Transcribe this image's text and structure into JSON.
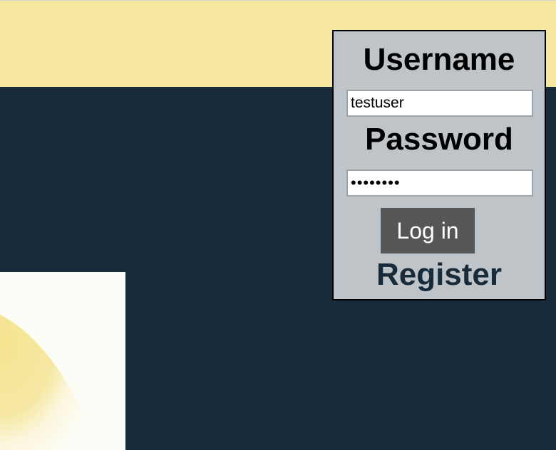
{
  "login": {
    "username_label": "Username",
    "username_value": "testuser",
    "password_label": "Password",
    "password_value": "password",
    "login_button_label": "Log in",
    "register_link_label": "Register"
  },
  "colors": {
    "banner": "#f6e89e",
    "background": "#172b3a",
    "panel": "#bfc4c9",
    "button": "#565656",
    "register_text": "#172b3a"
  }
}
